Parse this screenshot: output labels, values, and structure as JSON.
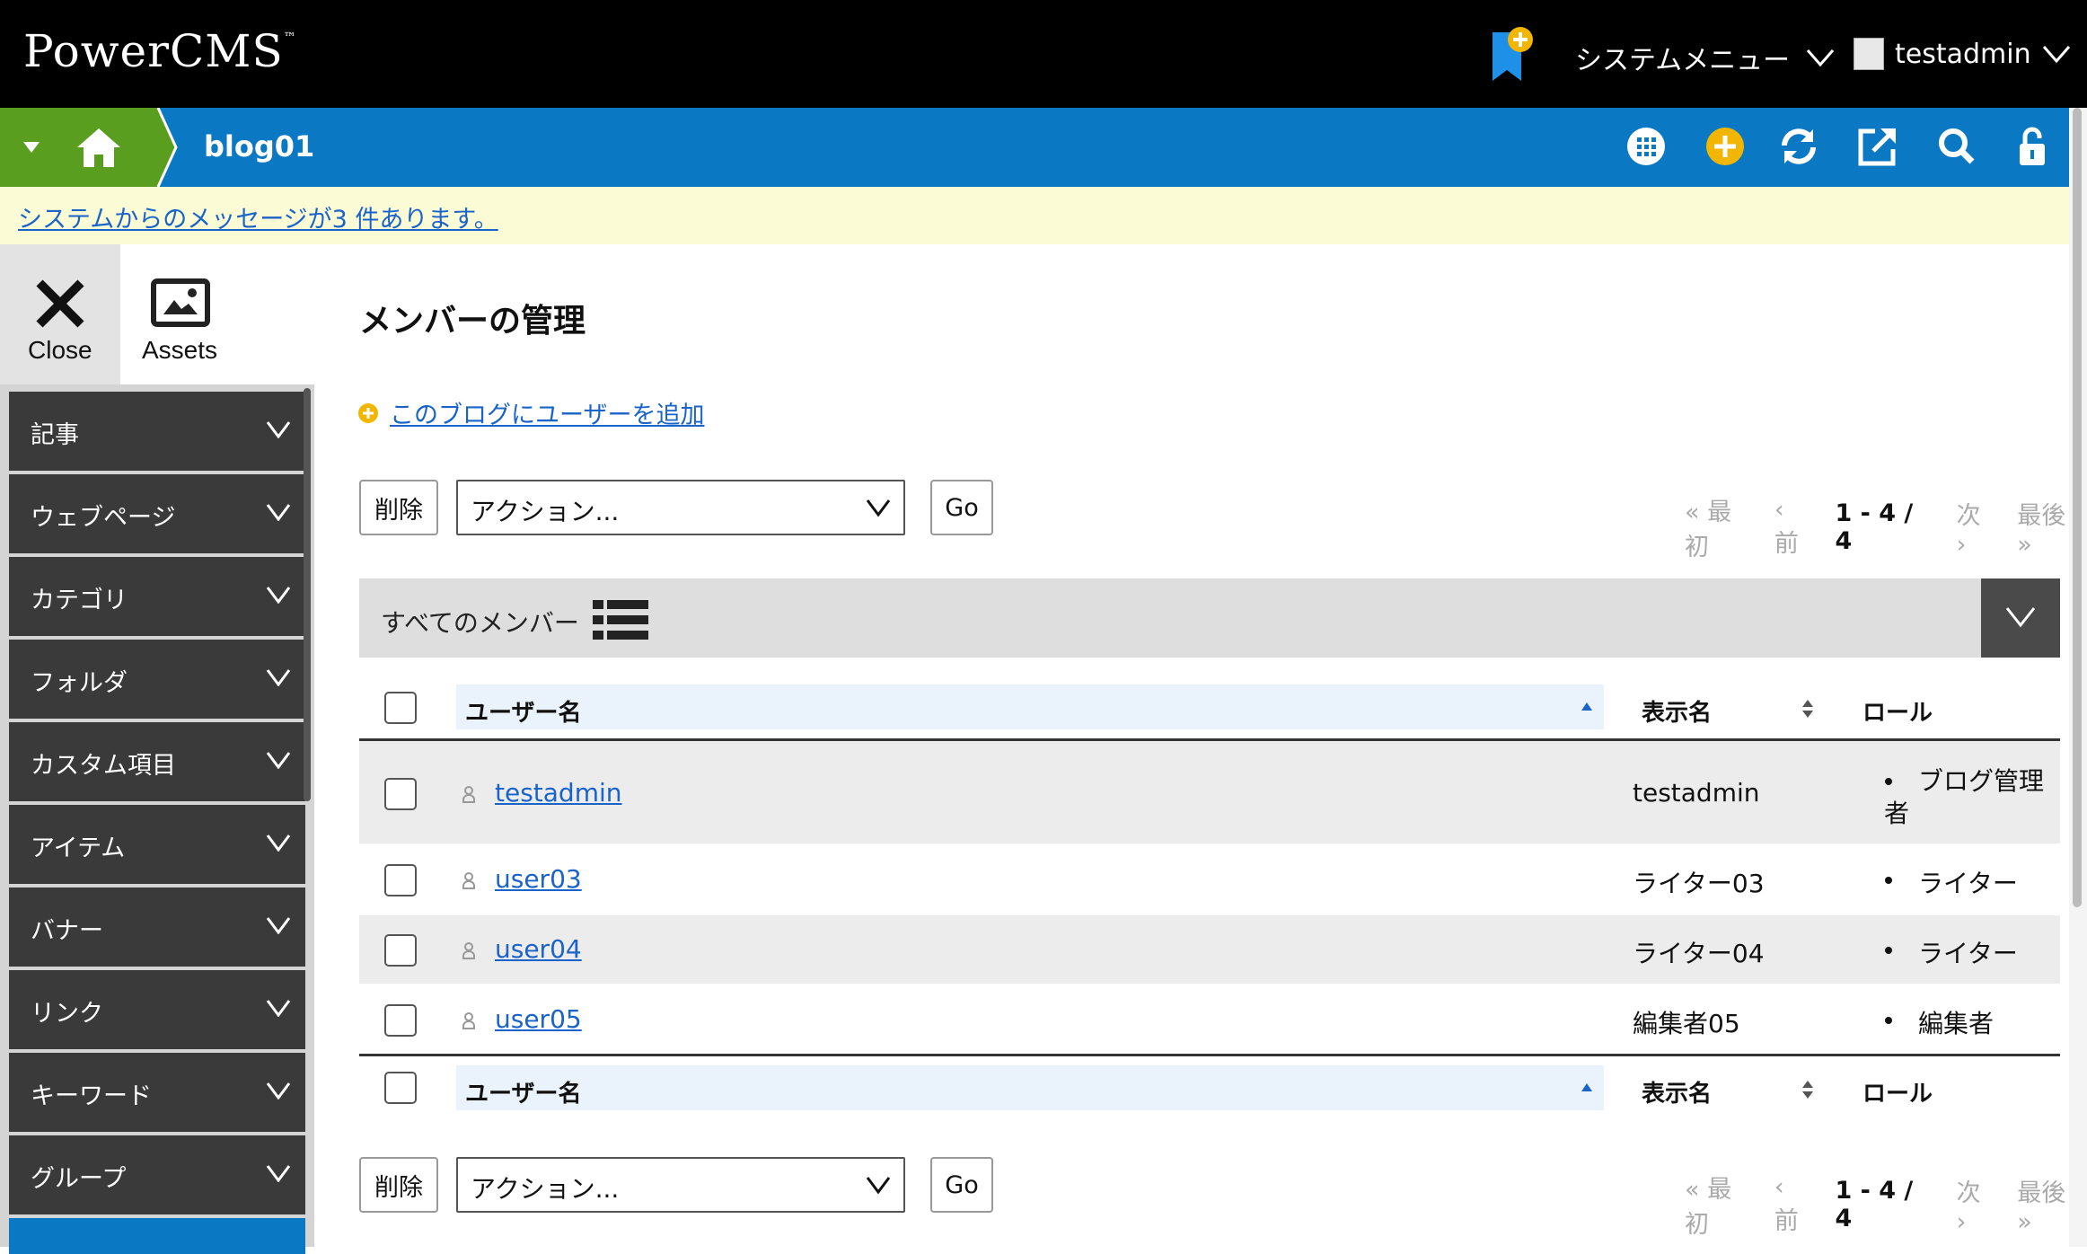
{
  "app": {
    "logo": "PowerCMS",
    "logo_tm": "™",
    "system_menu": "システムメニュー",
    "username": "testadmin"
  },
  "blog": {
    "name": "blog01"
  },
  "message_bar": {
    "text": "システムからのメッセージが3 件あります。"
  },
  "side_tabs": {
    "close": "Close",
    "assets": "Assets"
  },
  "sidebar": {
    "items": [
      {
        "label": "記事"
      },
      {
        "label": "ウェブページ"
      },
      {
        "label": "カテゴリ"
      },
      {
        "label": "フォルダ"
      },
      {
        "label": "カスタム項目"
      },
      {
        "label": "アイテム"
      },
      {
        "label": "バナー"
      },
      {
        "label": "リンク"
      },
      {
        "label": "キーワード"
      },
      {
        "label": "グループ"
      }
    ]
  },
  "main": {
    "title": "メンバーの管理",
    "add_user_link": "このブログにユーザーを追加",
    "delete_button": "削除",
    "action_select": "アクション...",
    "go_button": "Go",
    "pager": {
      "first": "« 最初",
      "prev": "‹ 前",
      "range": "1 - 4 / 4",
      "next": "次 ›",
      "last": "最後 »"
    },
    "filter_label": "すべてのメンバー",
    "columns": {
      "username": "ユーザー名",
      "display_name": "表示名",
      "role": "ロール"
    },
    "rows": [
      {
        "username": "testadmin",
        "display_name": "testadmin",
        "role_line1": "ブログ管理",
        "role_line2": "者"
      },
      {
        "username": "user03",
        "display_name": "ライター03",
        "role_line1": "ライター",
        "role_line2": ""
      },
      {
        "username": "user04",
        "display_name": "ライター04",
        "role_line1": "ライター",
        "role_line2": ""
      },
      {
        "username": "user05",
        "display_name": "編集者05",
        "role_line1": "編集者",
        "role_line2": ""
      }
    ]
  },
  "colors": {
    "topbar": "#000000",
    "bluebar": "#0a78c2",
    "green": "#5a9e1f",
    "link": "#1a63c9",
    "message_bg": "#fbfbd6",
    "sidebar_item": "#3a3a3a",
    "accent_yellow": "#f2b600"
  }
}
